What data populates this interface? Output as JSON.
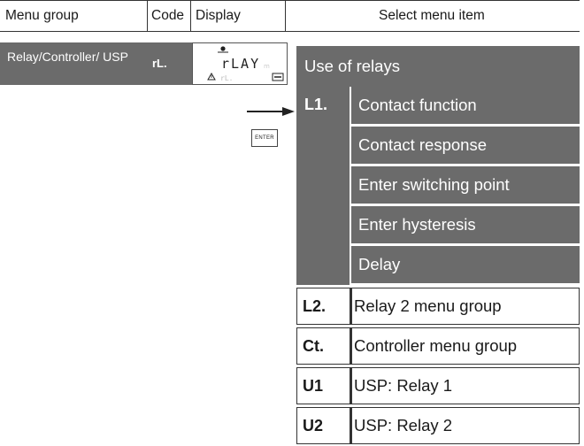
{
  "header": {
    "menu_group": "Menu group",
    "code": "Code",
    "display": "Display",
    "select_menu_item": "Select menu item"
  },
  "group": {
    "name": "Relay/Controller/ USP",
    "code": "rL.",
    "display_main": "rLAY",
    "display_sub": "rL."
  },
  "enter_key": "ENTER",
  "menu": {
    "top_item": "Use of relays",
    "l1": {
      "code": "L1.",
      "items": [
        "Contact function",
        "Contact response",
        "Enter switching point",
        "Enter hysteresis",
        "Delay"
      ]
    },
    "rows": [
      {
        "code": "L2.",
        "label": "Relay 2 menu group"
      },
      {
        "code": "Ct.",
        "label": "Controller menu group"
      },
      {
        "code": "U1",
        "label": "USP: Relay 1"
      },
      {
        "code": "U2",
        "label": "USP: Relay 2"
      }
    ]
  }
}
